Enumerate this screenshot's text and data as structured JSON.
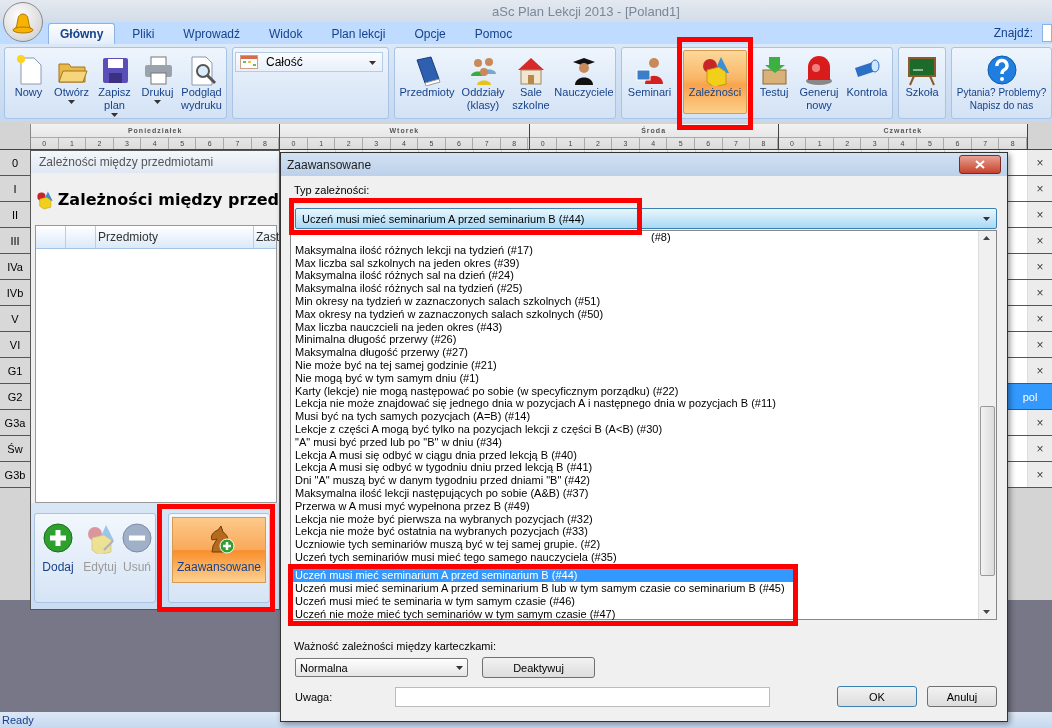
{
  "window": {
    "title": "aSc Plan Lekcji 2013  - [Poland1]"
  },
  "tabs": [
    {
      "label": "Główny",
      "selected": true
    },
    {
      "label": "Pliki",
      "selected": false
    },
    {
      "label": "Wprowadź",
      "selected": false
    },
    {
      "label": "Widok",
      "selected": false
    },
    {
      "label": "Plan lekcji",
      "selected": false
    },
    {
      "label": "Opcje",
      "selected": false
    },
    {
      "label": "Pomoc",
      "selected": false
    }
  ],
  "search": {
    "label": "Znajdź:"
  },
  "ribbon": [
    {
      "kind": "buttons",
      "items": [
        {
          "kind": "new",
          "label": "Nowy",
          "dropdown": false,
          "pressed": false
        },
        {
          "kind": "open",
          "label": "Otwórz",
          "dropdown": true,
          "pressed": false
        },
        {
          "kind": "save",
          "label": "Zapisz\nplan",
          "dropdown": true,
          "pressed": false
        },
        {
          "kind": "print",
          "label": "Drukuj",
          "dropdown": true,
          "pressed": false
        },
        {
          "kind": "preview",
          "label": "Podgląd\nwydruku",
          "dropdown": false,
          "pressed": false
        }
      ]
    },
    {
      "kind": "combo",
      "value": "Całość"
    },
    {
      "kind": "buttons",
      "items": [
        {
          "kind": "subjects",
          "label": "Przedmioty",
          "dropdown": false,
          "pressed": false
        },
        {
          "kind": "classes",
          "label": "Oddziały\n(klasy)",
          "dropdown": false,
          "pressed": false
        },
        {
          "kind": "rooms",
          "label": "Sale\nszkolne",
          "dropdown": false,
          "pressed": false
        },
        {
          "kind": "teachers",
          "label": "Nauczyciele",
          "dropdown": false,
          "pressed": false
        }
      ]
    },
    {
      "kind": "buttons",
      "items": [
        {
          "kind": "seminars",
          "label": "Seminari",
          "dropdown": false,
          "pressed": false
        },
        {
          "kind": "constraints",
          "label": "Zależności",
          "dropdown": false,
          "pressed": true
        },
        {
          "kind": "test",
          "label": "Testuj",
          "dropdown": false,
          "pressed": false
        },
        {
          "kind": "generate",
          "label": "Generuj\nnowy",
          "dropdown": false,
          "pressed": false
        },
        {
          "kind": "check",
          "label": "Kontrola",
          "dropdown": false,
          "pressed": false
        }
      ]
    },
    {
      "kind": "buttons",
      "items": [
        {
          "kind": "school",
          "label": "Szkoła",
          "dropdown": false,
          "pressed": false
        }
      ]
    },
    {
      "kind": "buttons",
      "items": [
        {
          "kind": "help",
          "label": "Pytania? Problemy?\nNapisz do nas",
          "dropdown": false,
          "pressed": false
        }
      ]
    }
  ],
  "timetable": {
    "days": [
      {
        "name": "Poniedziałek",
        "periods": [
          "0",
          "1",
          "2",
          "3",
          "4",
          "5",
          "6",
          "7",
          "8"
        ]
      },
      {
        "name": "Wtorek",
        "periods": [
          "0",
          "1",
          "2",
          "3",
          "4",
          "5",
          "6",
          "7",
          "8"
        ]
      },
      {
        "name": "Środa",
        "periods": [
          "0",
          "1",
          "2",
          "3",
          "4",
          "5",
          "6",
          "7",
          "8"
        ]
      },
      {
        "name": "Czwartek",
        "periods": [
          "0",
          "1",
          "2",
          "3",
          "4",
          "5",
          "6",
          "7",
          "8"
        ]
      }
    ],
    "rows": [
      {
        "label": "0",
        "remove": "×"
      },
      {
        "label": "I",
        "remove": "×"
      },
      {
        "label": "II",
        "remove": "×"
      },
      {
        "label": "III",
        "remove": "×"
      },
      {
        "label": "IVa",
        "remove": "×"
      },
      {
        "label": "IVb",
        "remove": "×"
      },
      {
        "label": "V",
        "remove": "×"
      },
      {
        "label": "VI",
        "remove": "×"
      },
      {
        "label": "G1",
        "remove": "×"
      },
      {
        "label": "G2",
        "lesson": "pol"
      },
      {
        "label": "G3a",
        "remove": "×"
      },
      {
        "label": "Św",
        "remove": "×"
      },
      {
        "label": "G3b",
        "remove": "×"
      }
    ]
  },
  "constraints_window": {
    "title": "Zależności między przedmiotami",
    "heading": "Zależności między przed",
    "columns": [
      "Przedmioty",
      "Zast"
    ],
    "toolbar": [
      {
        "kind": "add",
        "label": "Dodaj",
        "disabled": false,
        "pressed": false
      },
      {
        "kind": "edit",
        "label": "Edytuj",
        "disabled": true,
        "pressed": false
      },
      {
        "kind": "remove",
        "label": "Usuń",
        "disabled": true,
        "pressed": false
      },
      {
        "kind": "advanced",
        "label": "Zaawansowane",
        "disabled": false,
        "pressed": true
      }
    ]
  },
  "advanced_dialog": {
    "title": "Zaawansowane",
    "type_label": "Typ zależności:",
    "type_value": "Uczeń musi mieć seminarium A przed seminarium B (#44)",
    "options": [
      {
        "kind": "partial",
        "label": "(#8)",
        "selected": false
      },
      {
        "kind": "full",
        "label": "Maksymalna ilość różnych lekcji na tydzień (#17)",
        "selected": false
      },
      {
        "kind": "full",
        "label": "Max liczba sal szkolnych na jeden okres (#39)",
        "selected": false
      },
      {
        "kind": "full",
        "label": "Maksymalna ilość różnych sal na dzień (#24)",
        "selected": false
      },
      {
        "kind": "full",
        "label": "Maksymalna ilość różnych sal na tydzień (#25)",
        "selected": false
      },
      {
        "kind": "full",
        "label": "Min okresy na tydzień w zaznaczonych salach szkolnych (#51)",
        "selected": false
      },
      {
        "kind": "full",
        "label": "Max okresy na tydzień w zaznaczonych salach szkolnych (#50)",
        "selected": false
      },
      {
        "kind": "full",
        "label": "Max liczba nauczcieli na jeden okres (#43)",
        "selected": false
      },
      {
        "kind": "full",
        "label": "Minimalna długość przerwy (#26)",
        "selected": false
      },
      {
        "kind": "full",
        "label": "Maksymalna długość przerwy (#27)",
        "selected": false
      },
      {
        "kind": "full",
        "label": "Nie może być na tej samej godzinie (#21)",
        "selected": false
      },
      {
        "kind": "full",
        "label": "Nie mogą być w tym samym dniu (#1)",
        "selected": false
      },
      {
        "kind": "full",
        "label": "Karty (lekcje) nie mogą następować po sobie (w specyficznym porządku) (#22)",
        "selected": false
      },
      {
        "kind": "full",
        "label": "Lekcja nie może znajdować się jednego dnia w pozycjach A i następnego dnia w pozycjach B (#11)",
        "selected": false
      },
      {
        "kind": "full",
        "label": "Musi być na tych samych pozycjach (A=B) (#14)",
        "selected": false
      },
      {
        "kind": "full",
        "label": "Lekcje z części A mogą być tylko na pozycjach lekcji z części B (A<B) (#30)",
        "selected": false
      },
      {
        "kind": "full",
        "label": "\"A\" musi być przed lub po \"B\" w dniu (#34)",
        "selected": false
      },
      {
        "kind": "full",
        "label": "Lekcja A musi się odbyć w ciągu dnia przed lekcją B (#40)",
        "selected": false
      },
      {
        "kind": "full",
        "label": "Lekcja A musi się odbyć w tygodniu dniu przed lekcją B (#41)",
        "selected": false
      },
      {
        "kind": "full",
        "label": "Dni \"A\" muszą być w danym tygodniu przed dniami \"B\"  (#42)",
        "selected": false
      },
      {
        "kind": "full",
        "label": "Maksymalna ilość lekcji następujących po sobie (A&B) (#37)",
        "selected": false
      },
      {
        "kind": "full",
        "label": "Przerwa w A musi myć wypełnona przez B (#49)",
        "selected": false
      },
      {
        "kind": "full",
        "label": "Lekcja nie może być pierwsza na wybranych pozycjach (#32)",
        "selected": false
      },
      {
        "kind": "full",
        "label": "Lekcja nie może być ostatnia na wybranych pozycjach (#33)",
        "selected": false
      },
      {
        "kind": "full",
        "label": "Uczniowie tych seminariów muszą być w tej samej grupie. (#2)",
        "selected": false
      },
      {
        "kind": "full",
        "label": "Uczeń tych seminariów musi mieć tego samego nauczyciela (#35)",
        "selected": false
      },
      {
        "kind": "full",
        "label": "Uczeń musi mieć seminarium A przed seminarium B (#44)",
        "selected": true
      },
      {
        "kind": "full",
        "label": "Uczeń musi mieć seminarium A przed seminarium B lub w tym samym czasie co seminarium B (#45)",
        "selected": false
      },
      {
        "kind": "full",
        "label": "Uczeń musi mieć te seminaria w tym samym czasie (#46)",
        "selected": false
      },
      {
        "kind": "full",
        "label": "Uczeń nie może mieć tych seminariów w tym samym czasie (#47)",
        "selected": false
      }
    ],
    "weight_label": "Ważność zależności między karteczkami:",
    "weight_value": "Normalna",
    "deactivate": "Deaktywuj",
    "note_label": "Uwaga:",
    "ok": "OK",
    "cancel": "Anuluj"
  },
  "status_bar": {
    "text": "Ready"
  }
}
